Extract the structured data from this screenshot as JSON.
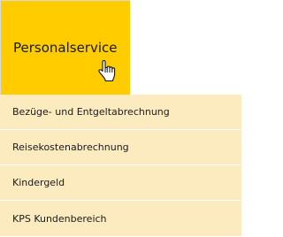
{
  "colors": {
    "tile_background": "#ffcc00",
    "menu_background": "#fdebc0",
    "text": "#1a1a1a"
  },
  "tile": {
    "label": "Personalservice",
    "cursor_icon": "hand-pointer-icon"
  },
  "menu": {
    "items": [
      {
        "label": "Bezüge- und Entgeltabrechnung"
      },
      {
        "label": "Reisekostenabrechnung"
      },
      {
        "label": "Kindergeld"
      },
      {
        "label": "KPS Kundenbereich"
      }
    ]
  }
}
